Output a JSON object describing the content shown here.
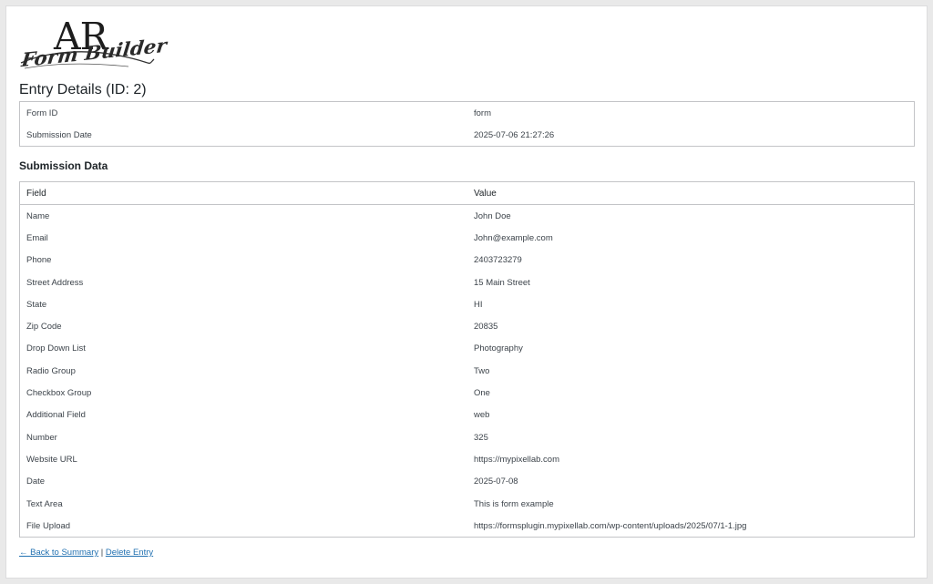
{
  "logo": {
    "monogram": "AR",
    "subtitle": "Form Builder"
  },
  "page_title": "Entry Details (ID: 2)",
  "meta": [
    {
      "label": "Form ID",
      "value": "form"
    },
    {
      "label": "Submission Date",
      "value": "2025-07-06 21:27:26"
    }
  ],
  "section_title": "Submission Data",
  "data_table": {
    "headers": {
      "field": "Field",
      "value": "Value"
    },
    "rows": [
      {
        "field": "Name",
        "value": "John Doe"
      },
      {
        "field": "Email",
        "value": "John@example.com"
      },
      {
        "field": "Phone",
        "value": "2403723279"
      },
      {
        "field": "Street Address",
        "value": "15 Main Street"
      },
      {
        "field": "State",
        "value": "HI"
      },
      {
        "field": "Zip Code",
        "value": "20835"
      },
      {
        "field": "Drop Down List",
        "value": "Photography"
      },
      {
        "field": "Radio Group",
        "value": "Two"
      },
      {
        "field": "Checkbox Group",
        "value": "One"
      },
      {
        "field": "Additional Field",
        "value": "web"
      },
      {
        "field": "Number",
        "value": "325"
      },
      {
        "field": "Website URL",
        "value": "https://mypixellab.com"
      },
      {
        "field": "Date",
        "value": "2025-07-08"
      },
      {
        "field": "Text Area",
        "value": "This is form example"
      },
      {
        "field": "File Upload",
        "value": "https://formsplugin.mypixellab.com/wp-content/uploads/2025/07/1-1.jpg"
      }
    ]
  },
  "footer": {
    "back_label": "← Back to Summary",
    "separator": "|",
    "delete_label": "Delete Entry"
  }
}
